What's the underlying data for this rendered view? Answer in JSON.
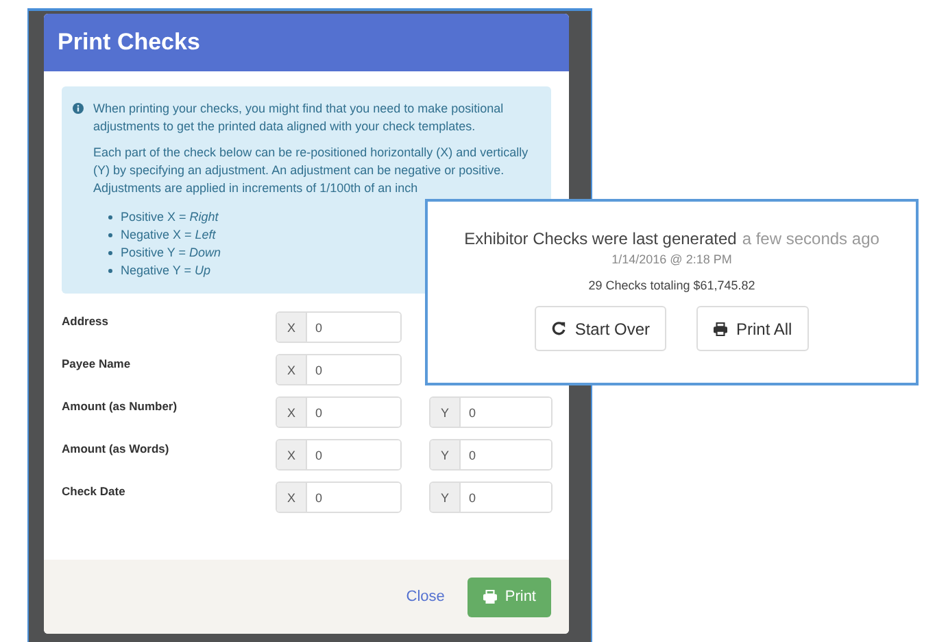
{
  "dialog": {
    "title": "Print Checks",
    "info": {
      "paragraphs": [
        "When printing your checks, you might find that you need to make positional adjustments to get the printed data aligned with your check templates.",
        "Each part of the check below can be re-positioned horizontally (X) and vertically (Y) by specifying an adjustment. An adjustment can be negative or positive. Adjustments are applied in increments of 1/100th of an inch"
      ],
      "bullets": [
        "Positive X = *Right*",
        "Negative X = *Left*",
        "Positive Y = *Down*",
        "Negative Y = *Up*"
      ]
    },
    "fields": [
      {
        "label": "Address",
        "x": {
          "addon": "X",
          "value": "0"
        }
      },
      {
        "label": "Payee Name",
        "x": {
          "addon": "X",
          "value": "0"
        }
      },
      {
        "label": "Amount (as Number)",
        "x": {
          "addon": "X",
          "value": "0"
        },
        "y": {
          "addon": "Y",
          "value": "0"
        }
      },
      {
        "label": "Amount (as Words)",
        "x": {
          "addon": "X",
          "value": "0"
        },
        "y": {
          "addon": "Y",
          "value": "0"
        }
      },
      {
        "label": "Check Date",
        "x": {
          "addon": "X",
          "value": "0"
        },
        "y": {
          "addon": "Y",
          "value": "0"
        }
      }
    ],
    "footer": {
      "close": "Close",
      "print": "Print"
    }
  },
  "summary": {
    "headline": "Exhibitor Checks were last generated",
    "relative_time": "a few seconds ago",
    "timestamp": "1/14/2016 @ 2:18 PM",
    "totals": "29 Checks totaling $61,745.82",
    "buttons": [
      {
        "kind": "restart",
        "label": "Start Over"
      },
      {
        "kind": "print",
        "label": "Print All"
      }
    ]
  }
}
